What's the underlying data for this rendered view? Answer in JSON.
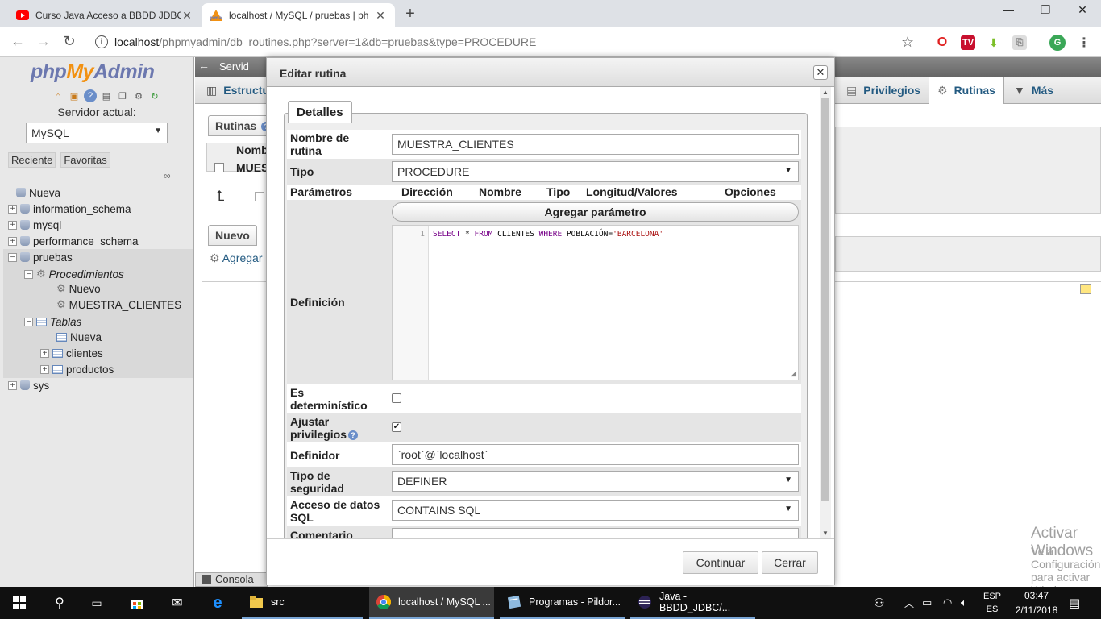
{
  "browser": {
    "tabs": [
      {
        "title": "Curso Java Acceso a BBDD JDBC",
        "icon": "youtube-icon",
        "active": false
      },
      {
        "title": "localhost / MySQL / pruebas | ph",
        "icon": "phpmyadmin-icon",
        "active": true
      }
    ],
    "new_tab": "+",
    "url_host": "localhost",
    "url_path": "/phpmyadmin/db_routines.php?server=1&db=pruebas&type=PROCEDURE",
    "extensions": [
      "opera-icon",
      "tv-icon",
      "download-icon",
      "pdf-icon",
      "profile-icon",
      "menu-icon"
    ],
    "profile_letter": "G"
  },
  "pma": {
    "logo": {
      "php": "php",
      "my": "My",
      "admin": "Admin"
    },
    "server_label": "Servidor actual:",
    "server_value": "MySQL",
    "nav_tabs": [
      "Reciente",
      "Favoritas"
    ],
    "tree": [
      {
        "label": "Nueva",
        "level": 0
      },
      {
        "label": "information_schema",
        "level": 0
      },
      {
        "label": "mysql",
        "level": 0
      },
      {
        "label": "performance_schema",
        "level": 0
      },
      {
        "label": "pruebas",
        "level": 0
      },
      {
        "label": "Procedimientos",
        "level": 1
      },
      {
        "label": "Nuevo",
        "level": 2
      },
      {
        "label": "MUESTRA_CLIENTES",
        "level": 2
      },
      {
        "label": "Tablas",
        "level": 1
      },
      {
        "label": "Nueva",
        "level": 2
      },
      {
        "label": "clientes",
        "level": 2
      },
      {
        "label": "productos",
        "level": 2
      },
      {
        "label": "sys",
        "level": 0
      }
    ],
    "topbar_server": "Servid",
    "menu": {
      "structure": "Estructu",
      "privileges": "Privilegios",
      "routines": "Rutinas",
      "more": "Más"
    },
    "routines_legend": "Rutinas",
    "table_header": "Nomb",
    "table_row": "MUES",
    "new_legend": "Nuevo",
    "add_link": "Agregar",
    "console": "Consola",
    "activate_title": "Activar Windows",
    "activate_sub": "Ve a Configuración para activar Windows."
  },
  "modal": {
    "title": "Editar rutina",
    "fieldset": "Detalles",
    "fields": {
      "name_label_1": "Nombre de",
      "name_label_2": "rutina",
      "name_value": "MUESTRA_CLIENTES",
      "type_label": "Tipo",
      "type_value": "PROCEDURE",
      "params_label": "Parámetros",
      "param_cols": [
        "Dirección",
        "Nombre",
        "Tipo",
        "Longitud/Valores",
        "Opciones"
      ],
      "add_param": "Agregar parámetro",
      "definition_label": "Definición",
      "code_line": "1",
      "code": {
        "select": "SELECT",
        "star": " * ",
        "from": "FROM",
        "table": " CLIENTES ",
        "where": "WHERE",
        "cond": " POBLACIÓN=",
        "value": "'BARCELONA'"
      },
      "deterministic_1": "Es",
      "deterministic_2": "determinístico",
      "deterministic_checked": false,
      "adjust_1": "Ajustar",
      "adjust_2": "privilegios",
      "adjust_checked": true,
      "definer_label": "Definidor",
      "definer_value": "`root`@`localhost`",
      "security_1": "Tipo de",
      "security_2": "seguridad",
      "security_value": "DEFINER",
      "sql_access_1": "Acceso de datos",
      "sql_access_2": "SQL",
      "sql_access_value": "CONTAINS SQL",
      "comment_label": "Comentario"
    },
    "continue": "Continuar",
    "close": "Cerrar"
  },
  "taskbar": {
    "items": [
      {
        "label": "src",
        "icon": "folder-icon"
      },
      {
        "label": "localhost / MySQL ...",
        "icon": "chrome-icon"
      },
      {
        "label": "Programas - Pildor...",
        "icon": "notepad-icon"
      },
      {
        "label": "Java - BBDD_JDBC/...",
        "icon": "eclipse-icon"
      }
    ],
    "lang_1": "ESP",
    "lang_2": "ES",
    "time": "03:47",
    "date": "2/11/2018"
  }
}
